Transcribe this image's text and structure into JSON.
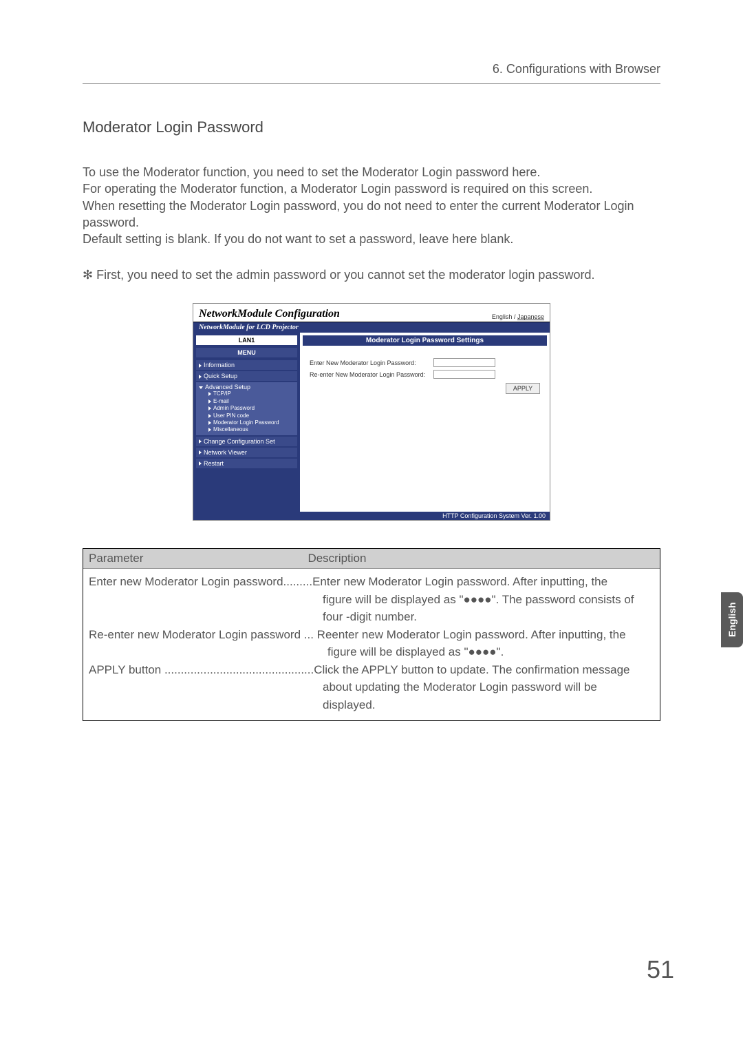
{
  "chapter_header": "6. Configurations with Browser",
  "section_title": "Moderator Login Password",
  "body_paragraph": "To use the Moderator function, you need to set the Moderator Login password here.\nFor operating the Moderator function, a Moderator Login password is required on this screen.\nWhen resetting the Moderator Login password, you do not need to enter the current Moderator Login password.\nDefault setting is blank.  If you do not want to set a password, leave here blank.",
  "note_line": "✻ First, you need to set the admin password or you cannot set the moderator login password.",
  "screenshot": {
    "title": "NetworkModule Configuration",
    "lang_en": "English",
    "lang_jp": "Japanese",
    "sub_bar": "NetworkModule for LCD Projector",
    "lan_slot": "LAN1",
    "menu_label": "MENU",
    "menu": {
      "information": "Information",
      "quick_setup": "Quick Setup",
      "advanced_setup": "Advanced Setup",
      "tcpip": "TCP/IP",
      "email": "E-mail",
      "admin_pw": "Admin Password",
      "user_pin": "User PIN code",
      "mod_login_pw": "Moderator Login Password",
      "misc": "Miscellaneous",
      "change_config": "Change Configuration Set",
      "network_viewer": "Network Viewer",
      "restart": "Restart"
    },
    "pane_title": "Moderator Login Password Settings",
    "enter_new_label": "Enter New Moderator Login Password:",
    "reenter_label": "Re-enter New Moderator Login Password:",
    "apply_btn": "APPLY",
    "version": "HTTP Configuration System Ver. 1.00"
  },
  "table": {
    "header_param": "Parameter",
    "header_desc": "Description",
    "row1_param": "Enter new Moderator Login password.........",
    "row1_desc_l1": "Enter new Moderator Login password.  After inputting, the",
    "row1_desc_l2": "figure will be displayed as \"●●●●\".  The password consists of",
    "row1_desc_l3": "four -digit number.",
    "row2_param": "Re-enter new Moderator Login password ...",
    "row2_desc_l1": " Reenter new Moderator Login password.  After inputting, the",
    "row2_desc_l2": "figure will be displayed as \"●●●●\".",
    "row3_param": "APPLY button ..............................................",
    "row3_desc_l1": "Click the APPLY button to update.  The confirmation message",
    "row3_desc_l2": "about updating the Moderator Login password will be",
    "row3_desc_l3": "displayed."
  },
  "side_tab": "English",
  "page_number": "51"
}
